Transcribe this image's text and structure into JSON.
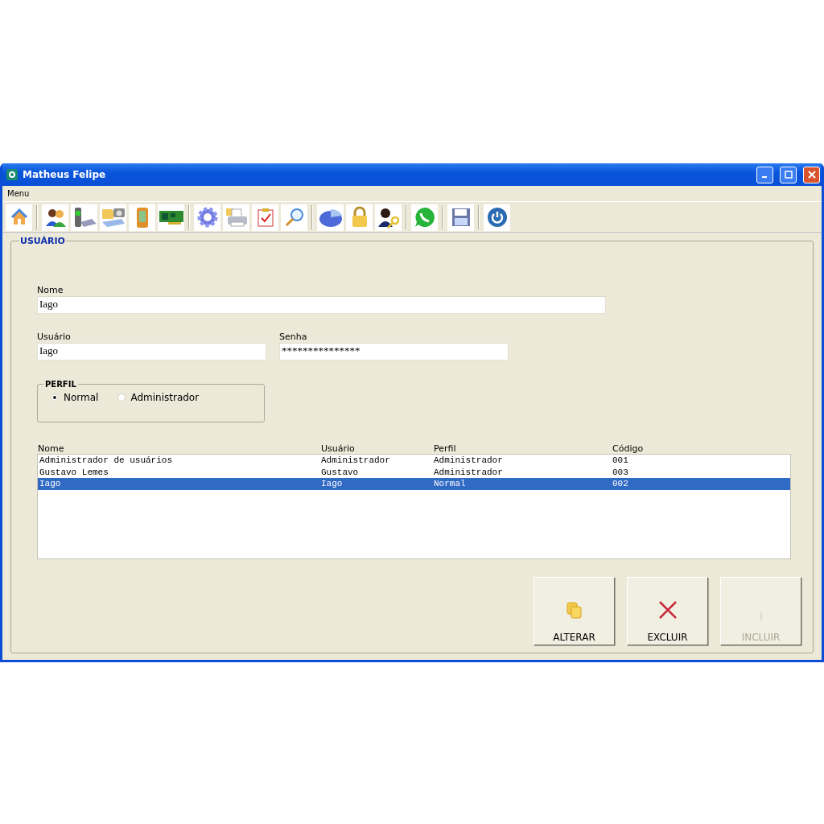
{
  "window": {
    "title": "Matheus Felipe"
  },
  "menu": [
    {
      "label": "Menu"
    }
  ],
  "group": {
    "title": "USUÁRIO"
  },
  "fields": {
    "nome": {
      "label": "Nome",
      "value": "Iago"
    },
    "usuario": {
      "label": "Usuário",
      "value": "Iago"
    },
    "senha": {
      "label": "Senha",
      "value": "***************"
    }
  },
  "perfil": {
    "title": "PERFIL",
    "options": [
      {
        "label": "Normal",
        "selected": true
      },
      {
        "label": "Administrador",
        "selected": false
      }
    ]
  },
  "table": {
    "columns": [
      "Nome",
      "Usuário",
      "Perfil",
      "Código"
    ],
    "rows": [
      {
        "cells": [
          "Administrador de usuários",
          "Administrador",
          "Administrador",
          "001"
        ],
        "selected": false
      },
      {
        "cells": [
          "Gustavo Lemes",
          "Gustavo",
          "Administrador",
          "003"
        ],
        "selected": false
      },
      {
        "cells": [
          "Iago",
          "Iago",
          "Normal",
          "002"
        ],
        "selected": true
      }
    ]
  },
  "buttons": [
    {
      "label": "ALTERAR",
      "disabled": false
    },
    {
      "label": "EXCLUIR",
      "disabled": false
    },
    {
      "label": "INCLUIR",
      "disabled": true
    }
  ]
}
